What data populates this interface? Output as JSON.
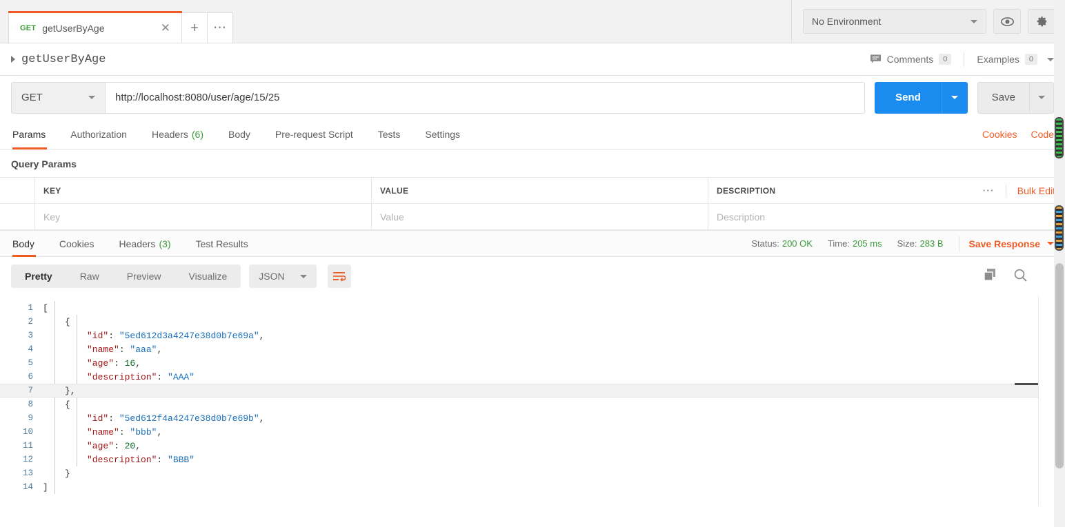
{
  "window": {
    "tab": {
      "method": "GET",
      "name": "getUserByAge",
      "close_icon": "close-icon"
    },
    "new_tab_icon": "plus-icon",
    "tab_menu_icon": "ellipsis-icon"
  },
  "environment": {
    "selected": "No Environment",
    "eye_icon": "eye-icon",
    "settings_icon": "gear-icon"
  },
  "breadcrumb": {
    "expand_icon": "triangle-right-icon",
    "title": "getUserByAge",
    "comments_label": "Comments",
    "comments_count": "0",
    "comments_icon": "comment-icon",
    "examples_label": "Examples",
    "examples_count": "0"
  },
  "request": {
    "method": "GET",
    "url": "http://localhost:8080/user/age/15/25",
    "send_label": "Send",
    "save_label": "Save",
    "tabs": [
      {
        "label": "Params",
        "count": "",
        "active": true
      },
      {
        "label": "Authorization",
        "count": "",
        "active": false
      },
      {
        "label": "Headers",
        "count": "(6)",
        "active": false
      },
      {
        "label": "Body",
        "count": "",
        "active": false
      },
      {
        "label": "Pre-request Script",
        "count": "",
        "active": false
      },
      {
        "label": "Tests",
        "count": "",
        "active": false
      },
      {
        "label": "Settings",
        "count": "",
        "active": false
      }
    ],
    "cookies_link": "Cookies",
    "code_link": "Code"
  },
  "params": {
    "section_title": "Query Params",
    "columns": {
      "key": "KEY",
      "value": "VALUE",
      "description": "DESCRIPTION"
    },
    "placeholders": {
      "key": "Key",
      "value": "Value",
      "description": "Description"
    },
    "more_icon": "ellipsis-icon",
    "bulk_edit": "Bulk Edit"
  },
  "response": {
    "tabs": [
      {
        "label": "Body",
        "count": "",
        "active": true
      },
      {
        "label": "Cookies",
        "count": "",
        "active": false
      },
      {
        "label": "Headers",
        "count": "(3)",
        "active": false
      },
      {
        "label": "Test Results",
        "count": "",
        "active": false
      }
    ],
    "status_label": "Status:",
    "status_value": "200 OK",
    "time_label": "Time:",
    "time_value": "205 ms",
    "size_label": "Size:",
    "size_value": "283 B",
    "save_response": "Save Response",
    "view_modes": [
      {
        "label": "Pretty",
        "active": true
      },
      {
        "label": "Raw",
        "active": false
      },
      {
        "label": "Preview",
        "active": false
      },
      {
        "label": "Visualize",
        "active": false
      }
    ],
    "format": "JSON",
    "wrap_icon": "word-wrap-icon",
    "copy_icon": "copy-icon",
    "search_icon": "search-icon",
    "body_lines": [
      {
        "n": "1",
        "indent": 0,
        "tokens": [
          {
            "t": "[",
            "c": "punc"
          }
        ]
      },
      {
        "n": "2",
        "indent": 1,
        "tokens": [
          {
            "t": "{",
            "c": "punc"
          }
        ]
      },
      {
        "n": "3",
        "indent": 2,
        "tokens": [
          {
            "t": "\"id\"",
            "c": "key"
          },
          {
            "t": ": ",
            "c": "punc"
          },
          {
            "t": "\"5ed612d3a4247e38d0b7e69a\"",
            "c": "str"
          },
          {
            "t": ",",
            "c": "punc"
          }
        ]
      },
      {
        "n": "4",
        "indent": 2,
        "tokens": [
          {
            "t": "\"name\"",
            "c": "key"
          },
          {
            "t": ": ",
            "c": "punc"
          },
          {
            "t": "\"aaa\"",
            "c": "str"
          },
          {
            "t": ",",
            "c": "punc"
          }
        ]
      },
      {
        "n": "5",
        "indent": 2,
        "tokens": [
          {
            "t": "\"age\"",
            "c": "key"
          },
          {
            "t": ": ",
            "c": "punc"
          },
          {
            "t": "16",
            "c": "num"
          },
          {
            "t": ",",
            "c": "punc"
          }
        ]
      },
      {
        "n": "6",
        "indent": 2,
        "tokens": [
          {
            "t": "\"description\"",
            "c": "key"
          },
          {
            "t": ": ",
            "c": "punc"
          },
          {
            "t": "\"AAA\"",
            "c": "str"
          }
        ]
      },
      {
        "n": "7",
        "indent": 1,
        "tokens": [
          {
            "t": "},",
            "c": "punc"
          }
        ],
        "highlight": true
      },
      {
        "n": "8",
        "indent": 1,
        "tokens": [
          {
            "t": "{",
            "c": "punc"
          }
        ]
      },
      {
        "n": "9",
        "indent": 2,
        "tokens": [
          {
            "t": "\"id\"",
            "c": "key"
          },
          {
            "t": ": ",
            "c": "punc"
          },
          {
            "t": "\"5ed612f4a4247e38d0b7e69b\"",
            "c": "str"
          },
          {
            "t": ",",
            "c": "punc"
          }
        ]
      },
      {
        "n": "10",
        "indent": 2,
        "tokens": [
          {
            "t": "\"name\"",
            "c": "key"
          },
          {
            "t": ": ",
            "c": "punc"
          },
          {
            "t": "\"bbb\"",
            "c": "str"
          },
          {
            "t": ",",
            "c": "punc"
          }
        ]
      },
      {
        "n": "11",
        "indent": 2,
        "tokens": [
          {
            "t": "\"age\"",
            "c": "key"
          },
          {
            "t": ": ",
            "c": "punc"
          },
          {
            "t": "20",
            "c": "num"
          },
          {
            "t": ",",
            "c": "punc"
          }
        ]
      },
      {
        "n": "12",
        "indent": 2,
        "tokens": [
          {
            "t": "\"description\"",
            "c": "key"
          },
          {
            "t": ": ",
            "c": "punc"
          },
          {
            "t": "\"BBB\"",
            "c": "str"
          }
        ]
      },
      {
        "n": "13",
        "indent": 1,
        "tokens": [
          {
            "t": "}",
            "c": "punc"
          }
        ]
      },
      {
        "n": "14",
        "indent": 0,
        "tokens": [
          {
            "t": "]",
            "c": "punc"
          }
        ]
      }
    ]
  },
  "colors": {
    "accent_orange": "#ef5b25",
    "send_blue": "#1a8cf0",
    "status_green": "#3a9a3a",
    "json_key": "#a31515",
    "json_string": "#1a6fbb",
    "json_number": "#096c25"
  }
}
